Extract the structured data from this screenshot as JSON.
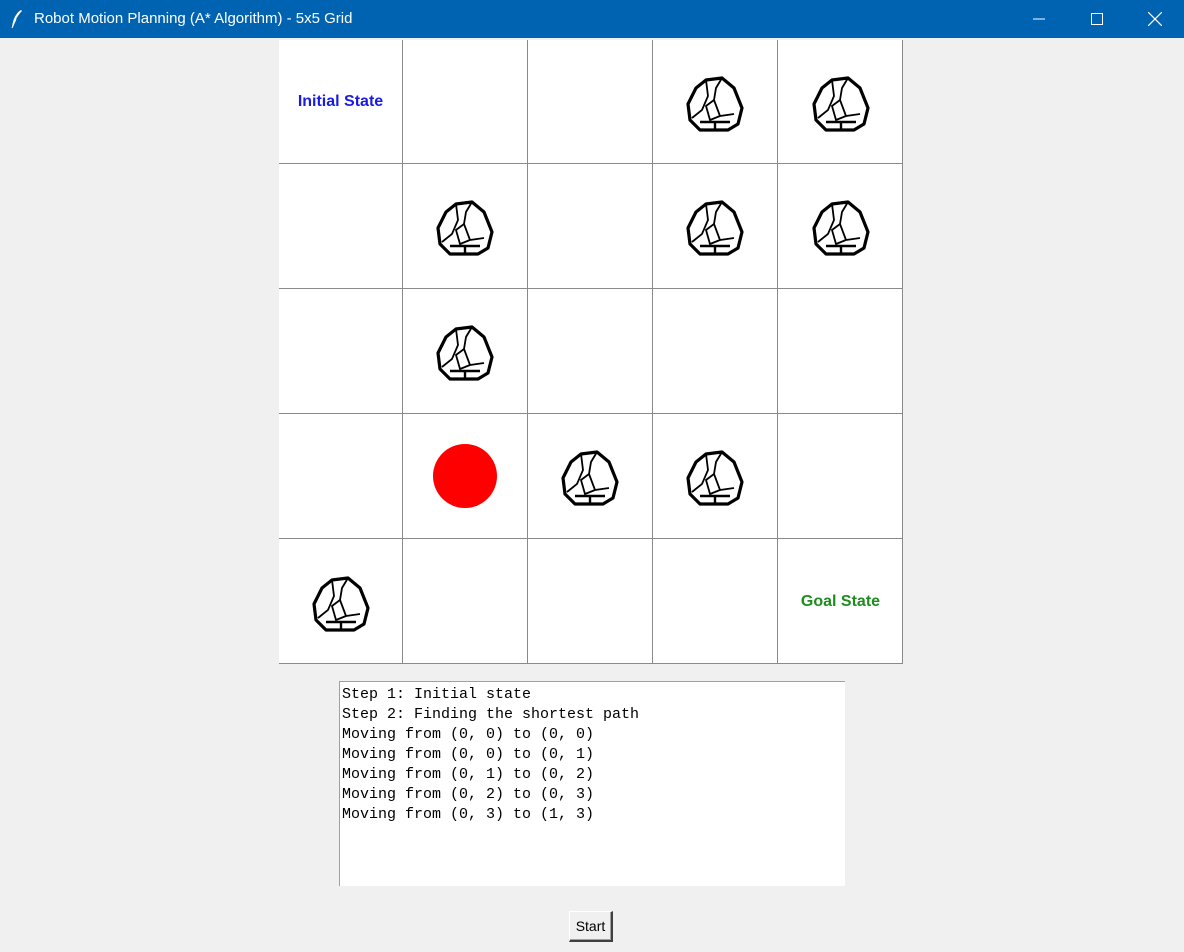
{
  "window": {
    "title": "Robot Motion Planning (A* Algorithm) - 5x5 Grid"
  },
  "grid": {
    "rows": 5,
    "cols": 5,
    "initial_label": "Initial State",
    "goal_label": "Goal State",
    "cells": [
      [
        "label-initial",
        "empty",
        "empty",
        "rock",
        "rock"
      ],
      [
        "empty",
        "rock",
        "empty",
        "rock",
        "rock"
      ],
      [
        "empty",
        "rock",
        "empty",
        "empty",
        "empty"
      ],
      [
        "empty",
        "robot",
        "rock",
        "rock",
        "empty"
      ],
      [
        "rock",
        "empty",
        "empty",
        "empty",
        "label-goal"
      ]
    ],
    "colors": {
      "initial_label": "#1a1ae6",
      "goal_label": "#1e8c1e",
      "robot": "#ff0000"
    }
  },
  "log": {
    "lines": [
      "Step 1: Initial state",
      "Step 2: Finding the shortest path",
      "Moving from (0, 0) to (0, 0)",
      "Moving from (0, 0) to (0, 1)",
      "Moving from (0, 1) to (0, 2)",
      "Moving from (0, 2) to (0, 3)",
      "Moving from (0, 3) to (1, 3)"
    ]
  },
  "controls": {
    "start_label": "Start"
  },
  "icons": {
    "app": "feather-icon",
    "obstacle": "rock-icon",
    "robot": "robot-marker"
  }
}
